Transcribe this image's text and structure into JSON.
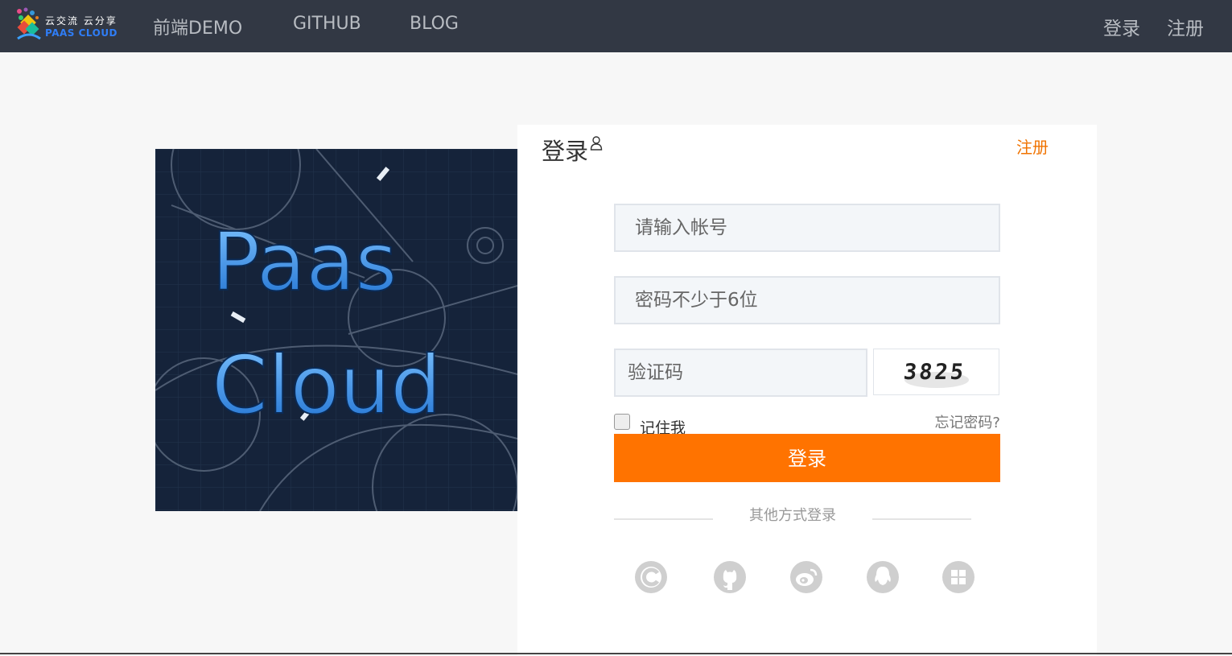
{
  "header": {
    "logo_slogan": "云交流 云分享",
    "logo_brand": "PAAS CLOUD",
    "nav": [
      {
        "label": "前端DEMO"
      },
      {
        "label": "GITHUB"
      },
      {
        "label": "BLOG"
      }
    ],
    "login_label": "登录",
    "register_label": "注册"
  },
  "banner": {
    "line1": "Paas",
    "line2": "Cloud"
  },
  "login": {
    "title": "登录",
    "register_link": "注册",
    "account_placeholder": "请输入帐号",
    "password_placeholder": "密码不少于6位",
    "captcha_placeholder": "验证码",
    "captcha_text": "3825",
    "remember_label": "记住我",
    "remember_checked": false,
    "forgot_label": "忘记密码?",
    "submit_label": "登录",
    "other_methods_label": "其他方式登录",
    "social_icons": [
      "csdn-icon",
      "github-icon",
      "weibo-icon",
      "qq-icon",
      "windows-icon"
    ]
  },
  "colors": {
    "header_bg": "#323844",
    "accent": "#ff7300",
    "page_bg": "#f7f7f7"
  }
}
